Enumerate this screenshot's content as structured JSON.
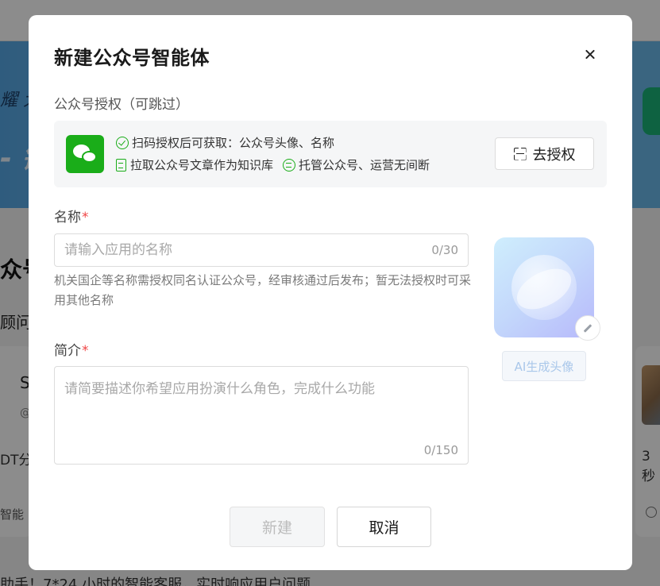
{
  "background": {
    "banner_text_1": "耀 大",
    "banner_text_2": "- 键",
    "section_title": "众号",
    "section_sub": "顾问",
    "card_left_name": "S",
    "card_left_handle": "@",
    "card_left_desc": "DT分",
    "card_left_tag": "智能",
    "card_right_desc": "3秒",
    "bottom_text": "助手！7*24 小时的智能客服，实时响应用户问题"
  },
  "modal": {
    "title": "新建公众号智能体",
    "close_icon": "close-icon",
    "auth": {
      "label": "公众号授权（可跳过）",
      "logo_icon": "wechat-logo-icon",
      "line1": "扫码授权后可获取：公众号头像、名称",
      "line2_a": "拉取公众号文章作为知识库",
      "line2_b": "托管公众号、运营无间断",
      "button_label": "去授权",
      "button_icon": "scan-icon",
      "accent_color": "#1aad19"
    },
    "name_field": {
      "label": "名称",
      "required_mark": "*",
      "placeholder": "请输入应用的名称",
      "value": "",
      "counter": "0/30",
      "hint": "机关国企等名称需授权同名认证公众号，经审核通过后发布；暂无法授权时可采用其他名称"
    },
    "intro_field": {
      "label": "简介",
      "required_mark": "*",
      "placeholder": "请简要描述你希望应用扮演什么角色，完成什么功能",
      "value": "",
      "counter": "0/150"
    },
    "avatar": {
      "edit_icon": "pencil-icon",
      "ai_button_label": "AI生成头像"
    },
    "footer": {
      "create_label": "新建",
      "cancel_label": "取消"
    }
  }
}
